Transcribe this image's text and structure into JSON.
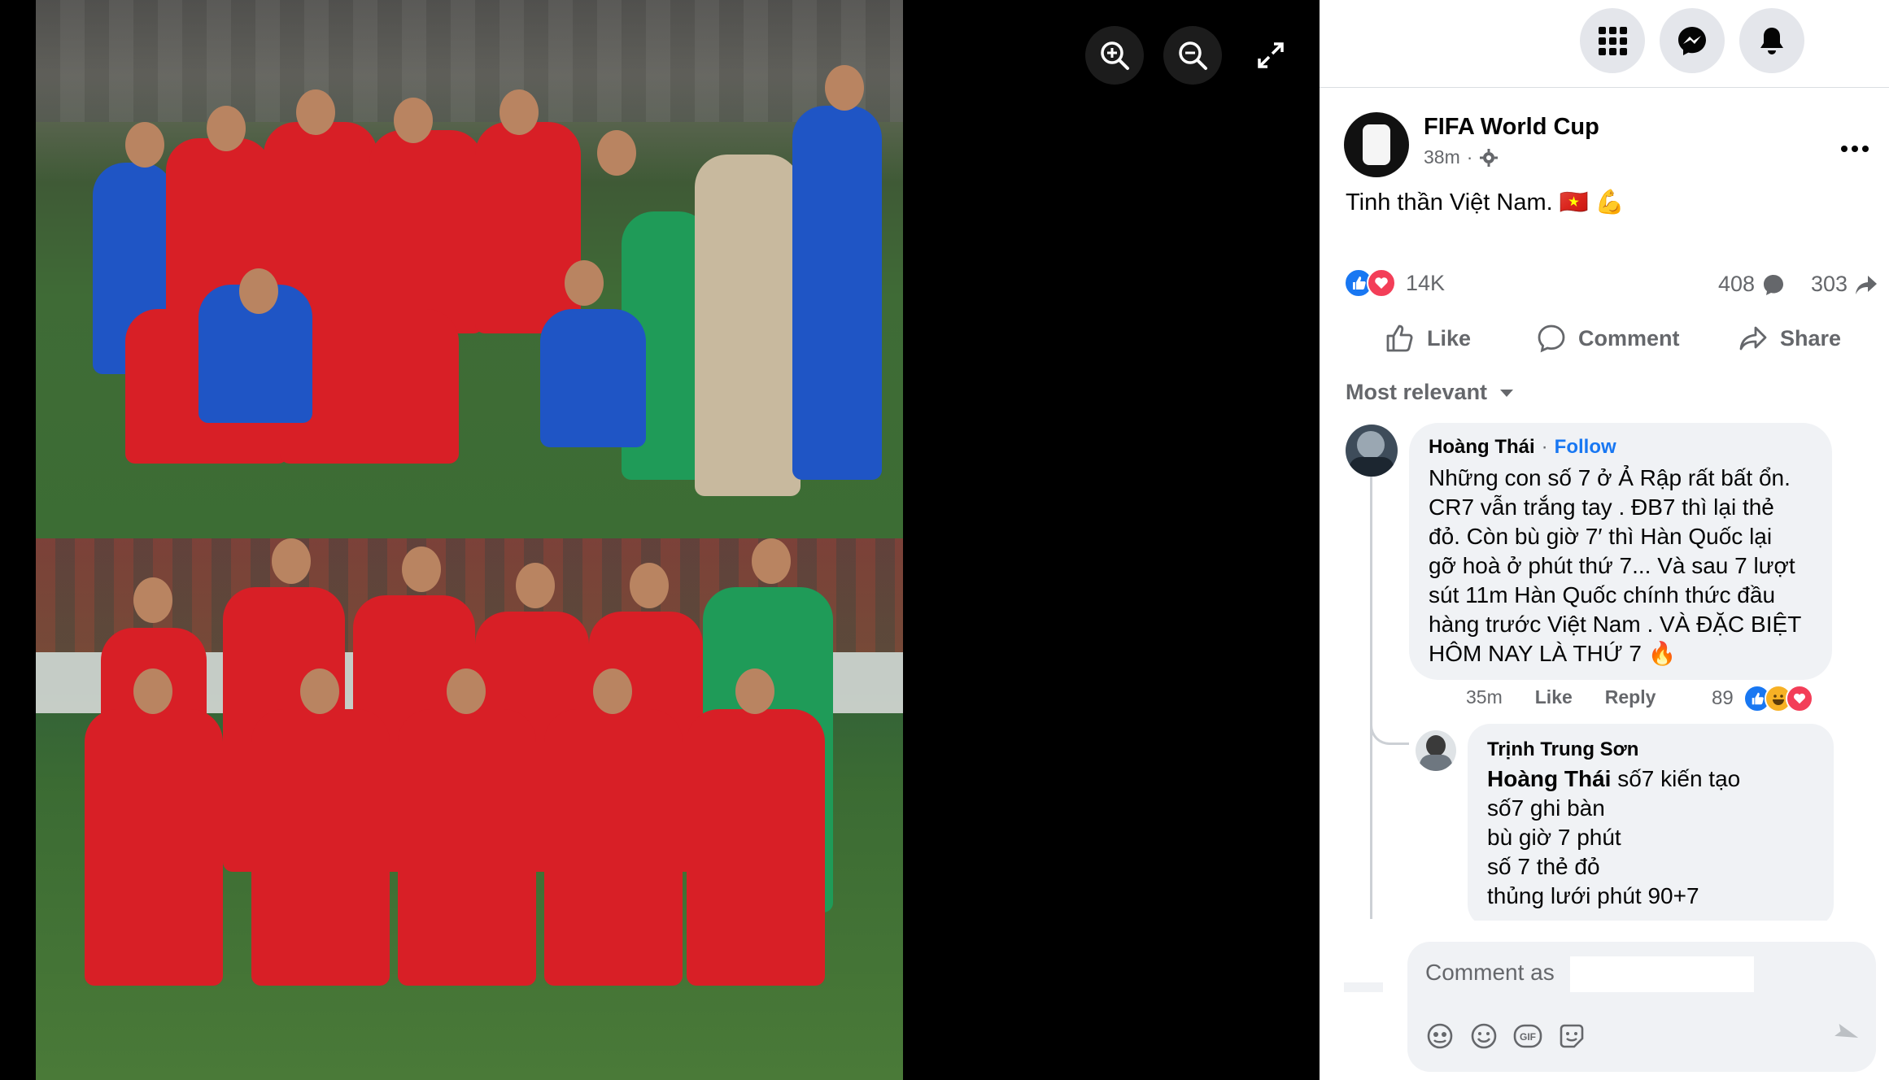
{
  "viewer": {
    "photo_alt": "Vietnam national team celebration and team photo",
    "toolbar": {
      "zoom_in": "zoom-in",
      "zoom_out": "zoom-out",
      "fullscreen": "fullscreen"
    }
  },
  "topbar": {
    "buttons": [
      "menu-grid",
      "messenger",
      "notifications"
    ]
  },
  "post": {
    "page_name": "FIFA World Cup",
    "time": "38m",
    "privacy_sep": "·",
    "text": "Tinh thần Việt Nam.",
    "emojis": [
      "🇻🇳",
      "💪"
    ],
    "reaction_count": "14K",
    "comment_count": "408",
    "share_count": "303",
    "actions": {
      "like": "Like",
      "comment": "Comment",
      "share": "Share"
    }
  },
  "comments": {
    "sort_label": "Most relevant",
    "items": [
      {
        "author": "Hoàng Thái",
        "follow_label": "Follow",
        "follow_sep": "·",
        "body": "Những con số 7 ở Ả Rập rất bất ổn.\nCR7 vẫn trắng tay . ĐB7 thì lại thẻ\nđỏ. Còn bù giờ 7′ thì Hàn Quốc lại\ngỡ hoà ở phút thứ 7... Và sau 7 lượt\nsút 11m Hàn Quốc chính thức đầu\nhàng trước Việt Nam . VÀ ĐẶC BIỆT\nHÔM NAY LÀ THỨ 7",
        "body_emoji": "🔥",
        "time": "35m",
        "like_label": "Like",
        "reply_label": "Reply",
        "reaction_count": "89"
      },
      {
        "author": "Trịnh Trung Sơn",
        "mention": "Hoàng Thái",
        "body_first": " số7 kiến tạo",
        "body_rest": "số7 ghi bàn\nbù giờ 7 phút\nsố 7 thẻ đỏ\nthủng lưới phút 90+7"
      }
    ]
  },
  "composer": {
    "placeholder": "Comment as",
    "icons": [
      "avatar-icon",
      "emoji-icon",
      "gif-icon",
      "sticker-icon",
      "send-icon"
    ]
  },
  "colors": {
    "fb_blue": "#1877f2",
    "love_red": "#f33e58",
    "haha_yellow": "#f7b125",
    "grey_text": "#65676b",
    "bubble_bg": "#f0f2f5"
  }
}
